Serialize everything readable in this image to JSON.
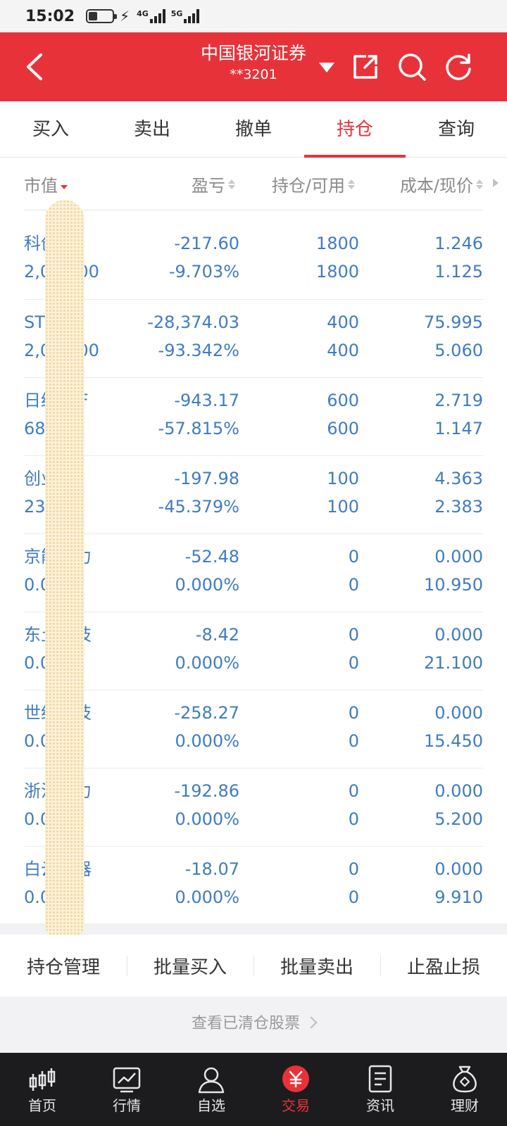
{
  "status_bar": {
    "time": "15:02",
    "net_4g": "4G",
    "net_5g": "5G"
  },
  "header": {
    "title": "中国银河证券",
    "account": "**3201",
    "bg_color": "#e8323a"
  },
  "tabs": [
    {
      "label": "买入",
      "active": false
    },
    {
      "label": "卖出",
      "active": false
    },
    {
      "label": "撤单",
      "active": false
    },
    {
      "label": "持仓",
      "active": true
    },
    {
      "label": "查询",
      "active": false
    }
  ],
  "columns": {
    "market_value": "市值",
    "profit_loss": "盈亏",
    "holding": "持仓/可用",
    "cost_price": "成本/现价"
  },
  "rows": [
    {
      "name": "科创50",
      "value": "2,025.00",
      "pl": "-217.60",
      "pl_pct": "-9.703%",
      "hold": "1800",
      "avail": "1800",
      "cost": "1.246",
      "price": "1.125"
    },
    {
      "name": "ST峨影",
      "value": "2,024.00",
      "pl": "-28,374.03",
      "pl_pct": "-93.342%",
      "hold": "400",
      "avail": "400",
      "cost": "75.995",
      "price": "5.060"
    },
    {
      "name": "日经ETF",
      "value": "688.20",
      "pl": "-943.17",
      "pl_pct": "-57.815%",
      "hold": "600",
      "avail": "600",
      "cost": "2.719",
      "price": "1.147"
    },
    {
      "name": "创业板",
      "value": "238.30",
      "pl": "-197.98",
      "pl_pct": "-45.379%",
      "hold": "100",
      "avail": "100",
      "cost": "4.363",
      "price": "2.383"
    },
    {
      "name": "京能热力",
      "value": "0.00",
      "pl": "-52.48",
      "pl_pct": "0.000%",
      "hold": "0",
      "avail": "0",
      "cost": "0.000",
      "price": "10.950"
    },
    {
      "name": "东土科技",
      "value": "0.00",
      "pl": "-8.42",
      "pl_pct": "0.000%",
      "hold": "0",
      "avail": "0",
      "cost": "0.000",
      "price": "21.100"
    },
    {
      "name": "世纪科技",
      "value": "0.00",
      "pl": "-258.27",
      "pl_pct": "0.000%",
      "hold": "0",
      "avail": "0",
      "cost": "0.000",
      "price": "15.450"
    },
    {
      "name": "浙江电力",
      "value": "0.00",
      "pl": "-192.86",
      "pl_pct": "0.000%",
      "hold": "0",
      "avail": "0",
      "cost": "0.000",
      "price": "5.200"
    },
    {
      "name": "白云电器",
      "value": "0.00",
      "pl": "-18.07",
      "pl_pct": "0.000%",
      "hold": "0",
      "avail": "0",
      "cost": "0.000",
      "price": "9.910"
    }
  ],
  "toolbar": [
    "持仓管理",
    "批量买入",
    "批量卖出",
    "止盈止损"
  ],
  "cleared_link": "查看已清仓股票",
  "bottom_nav": [
    {
      "label": "首页",
      "icon": "candlestick-icon",
      "active": false
    },
    {
      "label": "行情",
      "icon": "chart-icon",
      "active": false
    },
    {
      "label": "自选",
      "icon": "user-icon",
      "active": false
    },
    {
      "label": "交易",
      "icon": "yuan-icon",
      "active": true
    },
    {
      "label": "资讯",
      "icon": "document-icon",
      "active": false
    },
    {
      "label": "理财",
      "icon": "money-bag-icon",
      "active": false
    }
  ],
  "colors": {
    "accent": "#e8323a",
    "data_text": "#3f7cc0"
  }
}
